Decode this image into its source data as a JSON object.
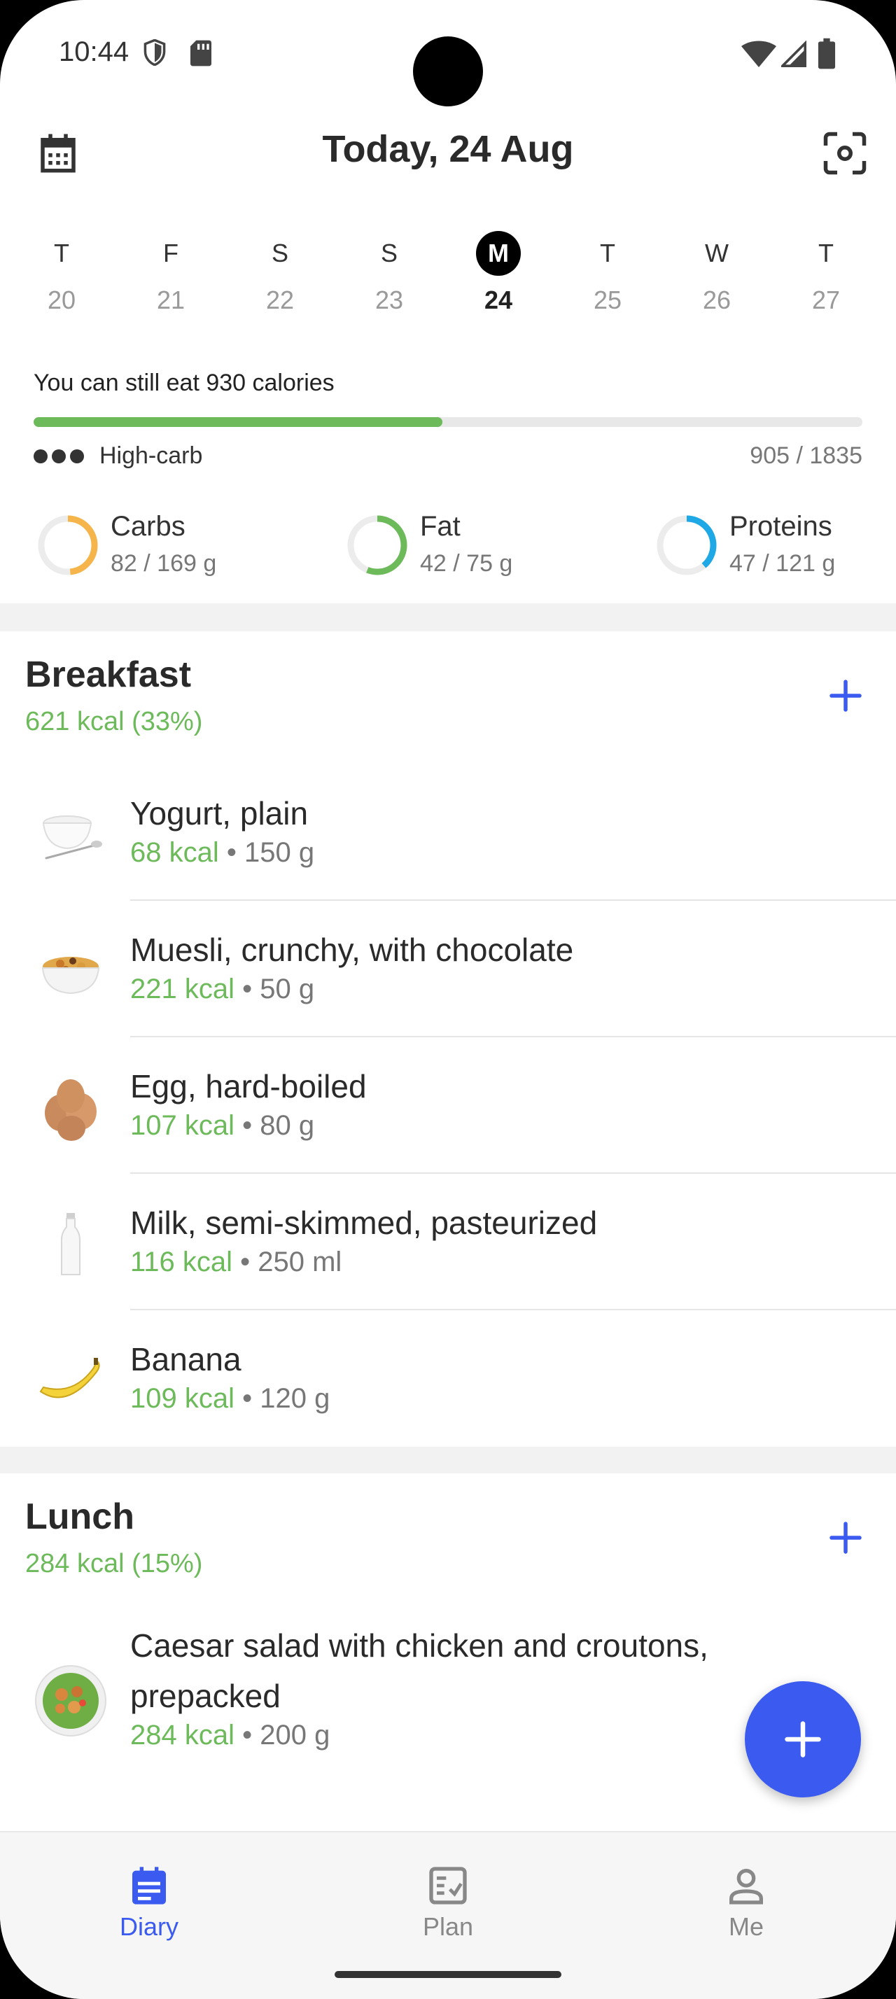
{
  "status_bar": {
    "time": "10:44"
  },
  "header": {
    "title": "Today, 24 Aug"
  },
  "week": [
    {
      "dow": "T",
      "date": "20",
      "active": false
    },
    {
      "dow": "F",
      "date": "21",
      "active": false
    },
    {
      "dow": "S",
      "date": "22",
      "active": false
    },
    {
      "dow": "S",
      "date": "23",
      "active": false
    },
    {
      "dow": "M",
      "date": "24",
      "active": true
    },
    {
      "dow": "T",
      "date": "25",
      "active": false
    },
    {
      "dow": "W",
      "date": "26",
      "active": false
    },
    {
      "dow": "T",
      "date": "27",
      "active": false
    }
  ],
  "summary": {
    "message": "You can still eat 930 calories",
    "diet": "High-carb",
    "count": "905 / 1835",
    "progress": 0.493
  },
  "macros": [
    {
      "name": "Carbs",
      "value": "82 / 169 g",
      "fraction": 0.485,
      "color": "#f5b54a"
    },
    {
      "name": "Fat",
      "value": "42 / 75 g",
      "fraction": 0.56,
      "color": "#6cba5a"
    },
    {
      "name": "Proteins",
      "value": "47 / 121 g",
      "fraction": 0.388,
      "color": "#1fa8e6"
    }
  ],
  "meals": {
    "breakfast": {
      "name": "Breakfast",
      "kcal": "621 kcal (33%)",
      "items": [
        {
          "name": "Yogurt, plain",
          "kcal": "68 kcal",
          "amount": "150 g"
        },
        {
          "name": "Muesli, crunchy, with chocolate",
          "kcal": "221 kcal",
          "amount": "50 g"
        },
        {
          "name": "Egg, hard-boiled",
          "kcal": "107 kcal",
          "amount": "80 g"
        },
        {
          "name": "Milk, semi-skimmed, pasteurized",
          "kcal": "116 kcal",
          "amount": "250 ml"
        },
        {
          "name": "Banana",
          "kcal": "109 kcal",
          "amount": "120 g"
        }
      ]
    },
    "lunch": {
      "name": "Lunch",
      "kcal": "284 kcal (15%)",
      "items": [
        {
          "name": "Caesar salad with chicken and croutons, prepacked",
          "kcal": "284 kcal",
          "amount": "200 g"
        }
      ]
    }
  },
  "nav": [
    {
      "label": "Diary",
      "active": true
    },
    {
      "label": "Plan",
      "active": false
    },
    {
      "label": "Me",
      "active": false
    }
  ],
  "colors": {
    "accent": "#3b5bf0",
    "green": "#6cba5a"
  }
}
